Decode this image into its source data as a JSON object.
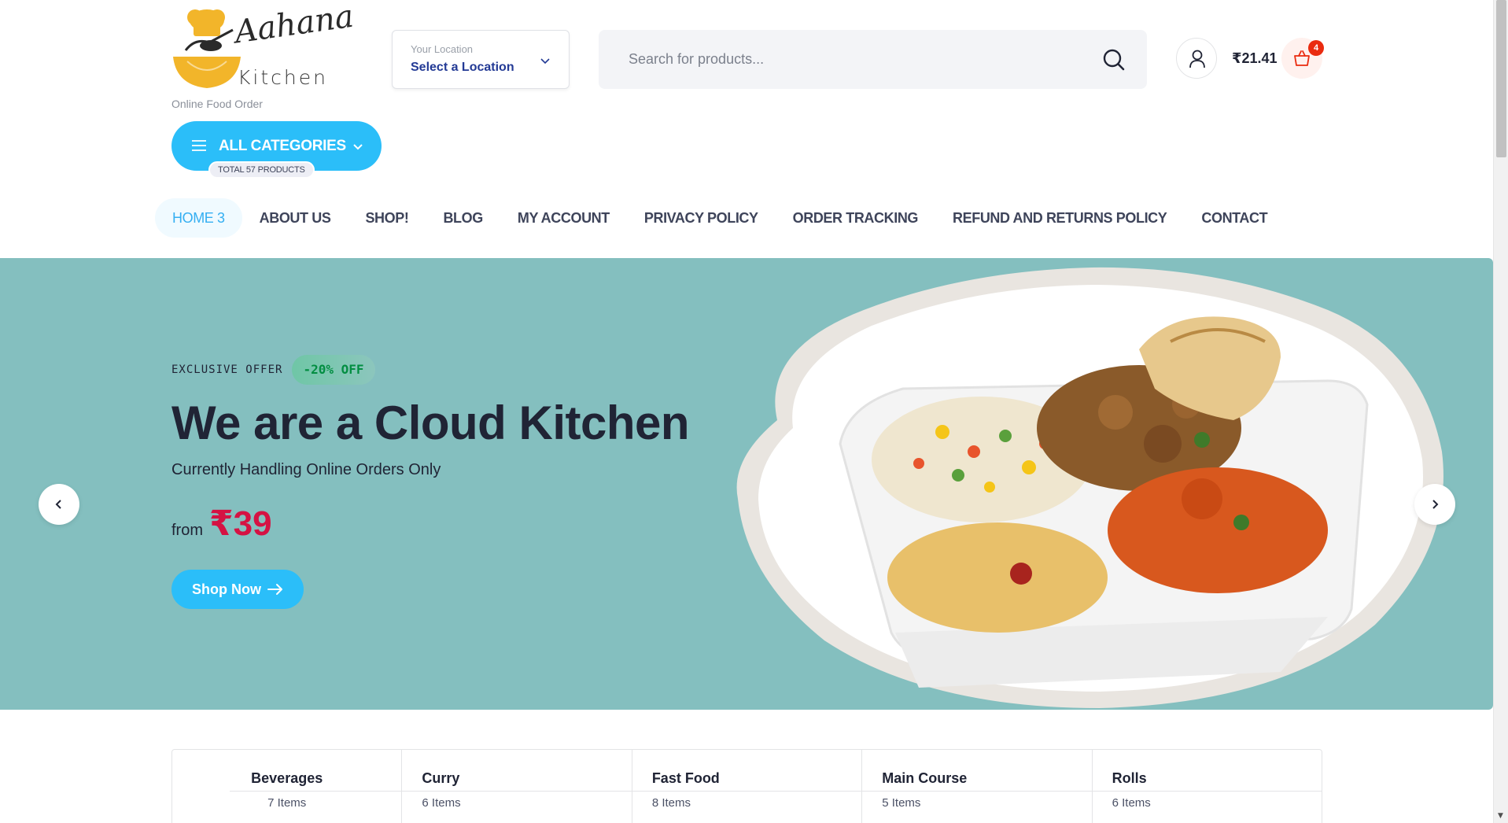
{
  "header": {
    "logo_text": "Aahana",
    "logo_kitchen": "Kitchen",
    "logo_subtitle": "Online Food Order",
    "location": {
      "label": "Your Location",
      "value": "Select a Location"
    },
    "search": {
      "placeholder": "Search for products..."
    },
    "cart": {
      "total": "₹21.41",
      "count": "4"
    }
  },
  "categories_menu": {
    "label": "ALL CATEGORIES",
    "badge": "TOTAL 57 PRODUCTS"
  },
  "nav": {
    "items": [
      {
        "label": "HOME 3"
      },
      {
        "label": "ABOUT US"
      },
      {
        "label": "SHOP!"
      },
      {
        "label": "BLOG"
      },
      {
        "label": "MY ACCOUNT"
      },
      {
        "label": "PRIVACY POLICY"
      },
      {
        "label": "ORDER TRACKING"
      },
      {
        "label": "REFUND AND RETURNS POLICY"
      },
      {
        "label": "CONTACT"
      }
    ]
  },
  "hero": {
    "offer_label": "EXCLUSIVE OFFER",
    "offer_badge": "-20% OFF",
    "title": "We are a Cloud Kitchen",
    "subtitle": "Currently Handling Online Orders Only",
    "from_label": "from",
    "price": "₹39",
    "button_label": "Shop Now",
    "background_color": "#84bfbf"
  },
  "categories": [
    {
      "name": "Beverages",
      "count": "7 Items"
    },
    {
      "name": "Curry",
      "count": "6 Items"
    },
    {
      "name": "Fast Food",
      "count": "8 Items"
    },
    {
      "name": "Main Course",
      "count": "5 Items"
    },
    {
      "name": "Rolls",
      "count": "6 Items"
    }
  ],
  "colors": {
    "accent": "#2bbef9",
    "price": "#d51243",
    "badge": "#ea2b0f",
    "text": "#202435"
  }
}
